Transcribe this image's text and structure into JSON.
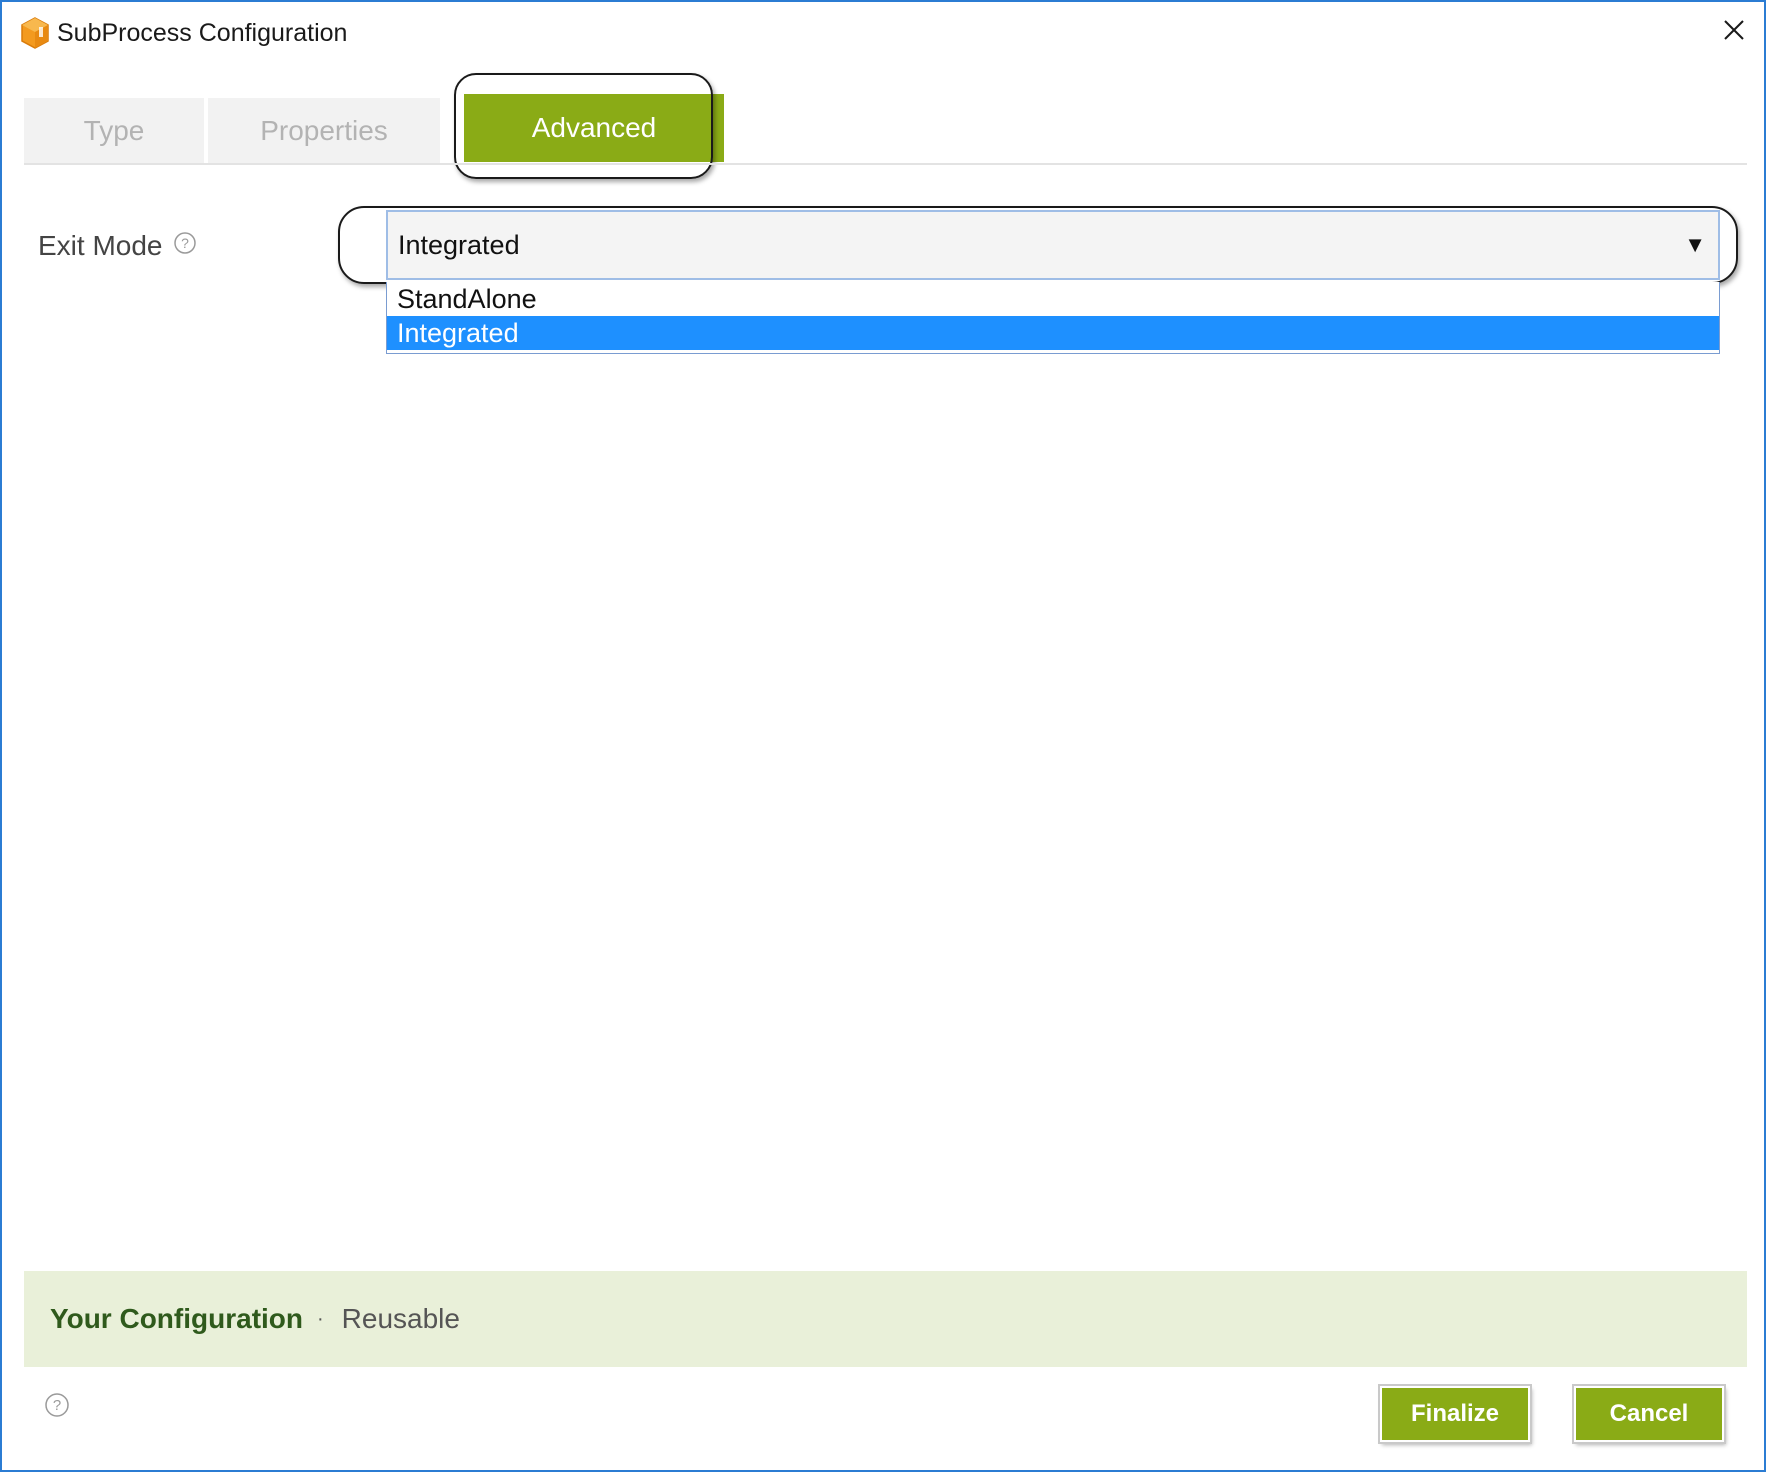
{
  "window": {
    "title": "SubProcess Configuration",
    "app_icon": "box-icon",
    "close_icon": "close-icon",
    "border_color": "#2b7cd3"
  },
  "tabs": [
    {
      "label": "Type",
      "active": false
    },
    {
      "label": "Properties",
      "active": false
    },
    {
      "label": "Advanced",
      "active": true
    }
  ],
  "advanced": {
    "exit_mode_label": "Exit Mode",
    "help_icon": "question-circle-icon",
    "exit_mode_value": "Integrated",
    "dropdown_arrow": "▼",
    "options": [
      {
        "label": "StandAlone",
        "selected": false
      },
      {
        "label": "Integrated",
        "selected": true
      }
    ]
  },
  "configuration": {
    "title": "Your Configuration",
    "separator": "·",
    "value": "Reusable"
  },
  "footer": {
    "help_icon": "question-circle-icon",
    "finalize_label": "Finalize",
    "cancel_label": "Cancel"
  },
  "colors": {
    "accent_green": "#8aab16",
    "selection_blue": "#1e90ff",
    "config_bar_bg": "#e9f0d9"
  }
}
